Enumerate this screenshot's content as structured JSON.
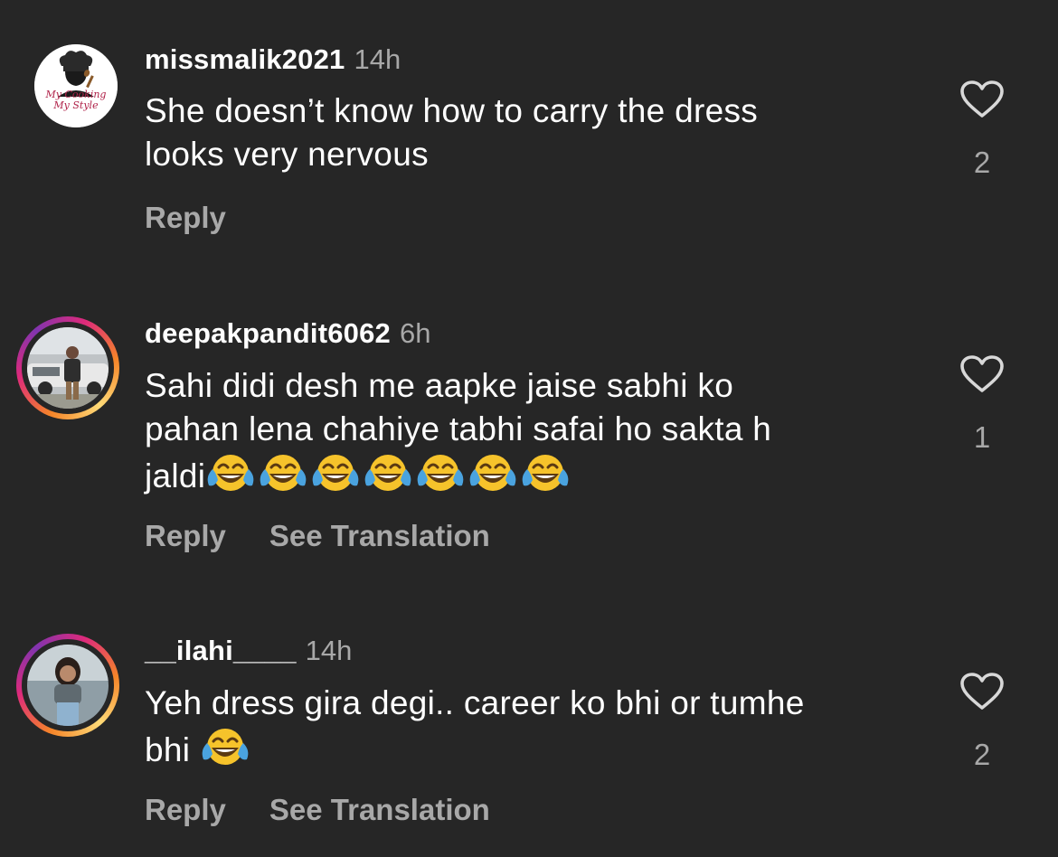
{
  "comments": [
    {
      "username": "missmalik2021",
      "time": "14h",
      "text_lines": [
        "She doesn’t know how to carry the dress",
        "looks very nervous"
      ],
      "likes": "2",
      "reply_label": "Reply",
      "translation_label": "",
      "avatar_logo_text": [
        "My Cooking",
        "My Style"
      ]
    },
    {
      "username": "deepakpandit6062",
      "time": "6h",
      "text_lines": [
        "Sahi didi desh me aapke jaise sabhi ko",
        "pahan lena chahiye tabhi safai ho sakta h",
        "jaldi"
      ],
      "emoji_count": 7,
      "emoji_name": "face-with-tears-of-joy",
      "likes": "1",
      "reply_label": "Reply",
      "translation_label": "See Translation"
    },
    {
      "username": "__ilahi____",
      "time": "14h",
      "text_lines": [
        "Yeh dress gira degi.. career ko bhi or tumhe",
        "bhi "
      ],
      "emoji_count": 1,
      "emoji_name": "face-with-tears-of-joy",
      "likes": "2",
      "reply_label": "Reply",
      "translation_label": "See Translation"
    }
  ],
  "colors": {
    "background": "#262626",
    "text": "#ffffff",
    "secondary": "#a8a8a8",
    "story_ring": [
      "#f58529",
      "#dd2a7b",
      "#8134af"
    ]
  },
  "icons": {
    "like": "heart-outline-icon",
    "emoji": "face-with-tears-of-joy"
  }
}
